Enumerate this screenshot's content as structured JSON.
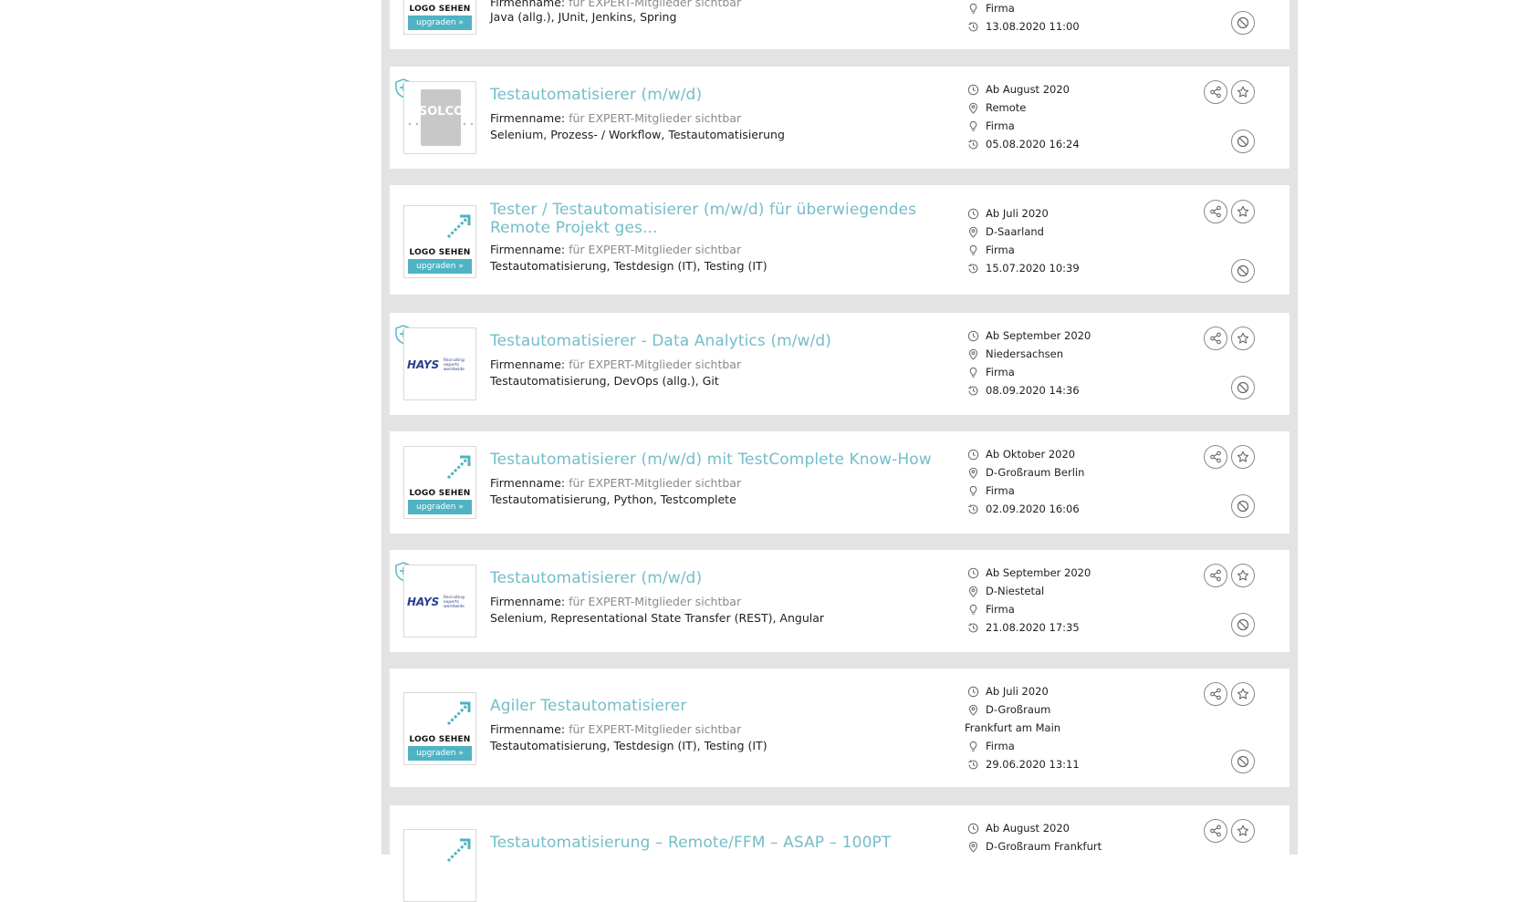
{
  "labels": {
    "company_label": "Firmenname:",
    "company_value": "für EXPERT-Mitglieder sichtbar",
    "logo_placeholder_text": "LOGO SEHEN",
    "logo_upgrade_label": "upgraden »",
    "solcom_text": "SOLCOM",
    "hays_text": "HAYS",
    "hays_sub": "Recruiting experts worldwide"
  },
  "icons": {
    "shield": "shield-plus-icon",
    "start": "clock-icon",
    "location": "map-pin-icon",
    "company": "lightbulb-icon",
    "updated": "history-icon",
    "share": "share-icon",
    "favorite": "star-icon",
    "hide": "block-icon"
  },
  "colors": {
    "title": "#74bdc9",
    "accent": "#4fb3c4",
    "shield": "#4fb3c4",
    "background_column": "#e3e3e3"
  },
  "listings": [
    {
      "title": "",
      "logo": "placeholder",
      "skills": "Java (allg.), JUnit, Jenkins, Spring",
      "start": "",
      "location": "",
      "company_type": "Firma",
      "updated": "13.08.2020 11:00"
    },
    {
      "title": "Testautomatisierer (m/w/d)",
      "logo": "solcom",
      "skills": "Selenium, Prozess- / Workflow, Testautomatisierung",
      "start": "Ab August 2020",
      "location": "Remote",
      "company_type": "Firma",
      "updated": "05.08.2020 16:24"
    },
    {
      "title": "Tester / Testautomatisierer (m/w/d) für überwiegendes Remote Projekt ges...",
      "logo": "placeholder",
      "skills": "Testautomatisierung, Testdesign (IT), Testing (IT)",
      "start": "Ab Juli 2020",
      "location": "D-Saarland",
      "company_type": "Firma",
      "updated": "15.07.2020 10:39"
    },
    {
      "title": "Testautomatisierer - Data Analytics (m/w/d)",
      "logo": "hays",
      "skills": "Testautomatisierung, DevOps (allg.), Git",
      "start": "Ab September 2020",
      "location": "Niedersachsen",
      "company_type": "Firma",
      "updated": "08.09.2020 14:36"
    },
    {
      "title": "Testautomatisierer (m/w/d) mit TestComplete Know-How",
      "logo": "placeholder",
      "skills": "Testautomatisierung, Python, Testcomplete",
      "start": "Ab Oktober 2020",
      "location": "D-Großraum Berlin",
      "company_type": "Firma",
      "updated": "02.09.2020 16:06"
    },
    {
      "title": "Testautomatisierer (m/w/d)",
      "logo": "hays",
      "skills": "Selenium, Representational State Transfer (REST), Angular",
      "start": "Ab September 2020",
      "location": "D-Niestetal",
      "company_type": "Firma",
      "updated": "21.08.2020 17:35"
    },
    {
      "title": "Agiler Testautomatisierer",
      "logo": "placeholder",
      "skills": "Testautomatisierung, Testdesign (IT), Testing (IT)",
      "start": "Ab Juli 2020",
      "location": "D-Großraum Frankfurt am Main",
      "company_type": "Firma",
      "updated": "29.06.2020 13:11"
    },
    {
      "title": "Testautomatisierung – Remote/FFM – ASAP – 100PT",
      "logo": "placeholder",
      "skills": "",
      "start": "Ab August 2020",
      "location": "D-Großraum Frankfurt",
      "company_type": "",
      "updated": ""
    }
  ]
}
